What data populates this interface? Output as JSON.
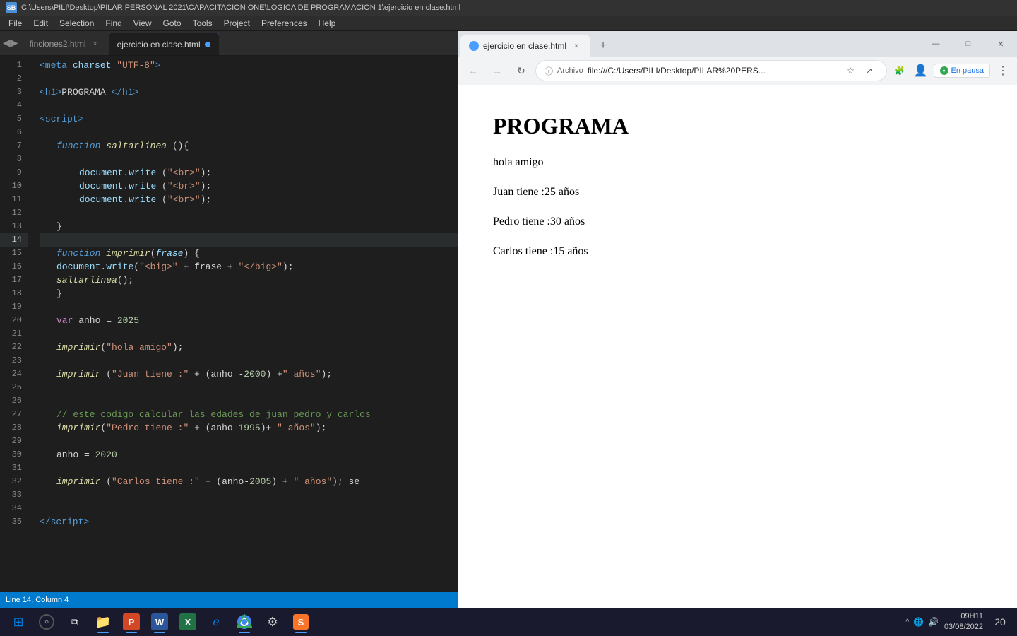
{
  "titlebar": {
    "path": "C:\\Users\\PILI\\Desktop\\PILAR PERSONAL 2021\\CAPACITACION ONE\\LOGICA DE PROGRAMACION 1\\ejercicio en clase.html",
    "icon_label": "SB"
  },
  "menubar": {
    "items": [
      "File",
      "Edit",
      "Selection",
      "Find",
      "View",
      "Goto",
      "Tools",
      "Project",
      "Preferences",
      "Help"
    ]
  },
  "editor": {
    "tabs": [
      {
        "id": "finciones2",
        "label": "finciones2.html",
        "active": false
      },
      {
        "id": "ejercicio",
        "label": "ejercicio en clase.html",
        "active": true
      }
    ],
    "current_line": 14,
    "current_col": 4,
    "lines": [
      {
        "num": 1,
        "content": "meta_line"
      },
      {
        "num": 2,
        "content": "empty"
      },
      {
        "num": 3,
        "content": "h1_line"
      },
      {
        "num": 4,
        "content": "empty"
      },
      {
        "num": 5,
        "content": "script_open"
      },
      {
        "num": 6,
        "content": "empty"
      },
      {
        "num": 7,
        "content": "func_saltarlinea"
      },
      {
        "num": 8,
        "content": "empty"
      },
      {
        "num": 9,
        "content": "doc_write_br1"
      },
      {
        "num": 10,
        "content": "doc_write_br2"
      },
      {
        "num": 11,
        "content": "doc_write_br3"
      },
      {
        "num": 12,
        "content": "empty"
      },
      {
        "num": 13,
        "content": "close_brace"
      },
      {
        "num": 14,
        "content": "empty_current"
      },
      {
        "num": 15,
        "content": "func_imprimir"
      },
      {
        "num": 16,
        "content": "doc_write_big"
      },
      {
        "num": 17,
        "content": "saltarlinea_call"
      },
      {
        "num": 18,
        "content": "close_brace"
      },
      {
        "num": 19,
        "content": "empty"
      },
      {
        "num": 20,
        "content": "var_anho"
      },
      {
        "num": 21,
        "content": "empty"
      },
      {
        "num": 22,
        "content": "imprimir_hola"
      },
      {
        "num": 23,
        "content": "empty"
      },
      {
        "num": 24,
        "content": "imprimir_juan"
      },
      {
        "num": 25,
        "content": "empty"
      },
      {
        "num": 26,
        "content": "empty"
      },
      {
        "num": 27,
        "content": "comment_edades"
      },
      {
        "num": 28,
        "content": "imprimir_pedro"
      },
      {
        "num": 29,
        "content": "empty"
      },
      {
        "num": 30,
        "content": "anho_2020"
      },
      {
        "num": 31,
        "content": "empty"
      },
      {
        "num": 32,
        "content": "imprimir_carlos"
      },
      {
        "num": 33,
        "content": "empty"
      },
      {
        "num": 34,
        "content": "empty"
      },
      {
        "num": 35,
        "content": "script_close"
      }
    ]
  },
  "status_bar": {
    "text": "Line 14, Column 4"
  },
  "browser": {
    "tab_title": "ejercicio en clase.html",
    "favicon": "◉",
    "nav": {
      "back_disabled": true,
      "forward_disabled": true,
      "url_label": "Archivo",
      "url": "file:///C:/Users/PILI/Desktop/PILAR%20PERS..."
    },
    "pause_btn": "En pausa",
    "content": {
      "heading": "PROGRAMA",
      "lines": [
        "hola amigo",
        "Juan tiene :25 años",
        "Pedro tiene :30 años",
        "Carlos tiene :15 años"
      ]
    },
    "window_controls": {
      "minimize": "—",
      "maximize": "□",
      "close": "✕"
    }
  },
  "taskbar": {
    "apps": [
      {
        "id": "start",
        "icon": "⊞",
        "color": "#0078d4"
      },
      {
        "id": "search",
        "icon": "○",
        "color": "white"
      },
      {
        "id": "taskview",
        "icon": "⧉",
        "color": "white"
      },
      {
        "id": "explorer",
        "icon": "📁",
        "color": "#f0c040"
      },
      {
        "id": "powerpoint",
        "icon": "P",
        "color": "#d24726"
      },
      {
        "id": "word",
        "icon": "W",
        "color": "#2b579a"
      },
      {
        "id": "excel",
        "icon": "X",
        "color": "#217346"
      },
      {
        "id": "edge",
        "icon": "e",
        "color": "#0078d4"
      },
      {
        "id": "chrome",
        "icon": "●",
        "color": "#4285f4"
      },
      {
        "id": "settings",
        "icon": "⚙",
        "color": "#cccccc"
      },
      {
        "id": "sublime",
        "icon": "S",
        "color": "#f97428"
      }
    ],
    "clock_time": "09H11",
    "clock_date": "03/08/2022",
    "notif_count": "20"
  }
}
